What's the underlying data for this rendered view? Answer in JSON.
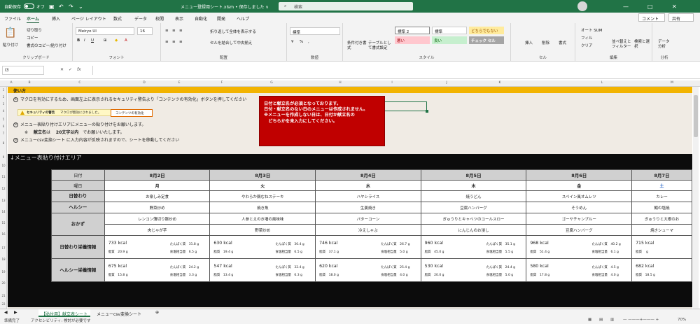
{
  "titlebar": {
    "autosave_label": "自動保存",
    "autosave_state": "オフ",
    "doc_title": "メニュー登録用シート.xlsm • 保存しました ∨",
    "search_placeholder": "検索",
    "bg_color": "#217346"
  },
  "menu": {
    "items": [
      "ファイル",
      "ホーム",
      "挿入",
      "ページ レイアウト",
      "数式",
      "データ",
      "校閲",
      "表示",
      "自動化",
      "開発",
      "ヘルプ"
    ],
    "active": "ホーム",
    "comment_label": "コメント",
    "share_label": "共有"
  },
  "ribbon": {
    "paste_label": "貼り付け",
    "cut_label": "切り取り",
    "copy_label": "コピー",
    "format_painter_label": "書式のコピー/貼り付け",
    "clipboard_group": "クリップボード",
    "font_name": "Meiryo UI",
    "font_size": "16",
    "font_group": "フォント",
    "wrap_label": "折り返して全体を表示する",
    "merge_label": "セルを結合して中央揃え",
    "align_group": "配置",
    "number_format": "標準",
    "number_group": "数値",
    "cond_format_label": "条件付き書式",
    "table_format_label": "テーブルとして書式設定",
    "styles": [
      {
        "label": "標準 2",
        "bg": "#ffffff",
        "fg": "#222222"
      },
      {
        "label": "標準",
        "bg": "#ffffff",
        "fg": "#222222"
      },
      {
        "label": "どちらでもない",
        "bg": "#ffeb9c",
        "fg": "#9c5700"
      },
      {
        "label": "悪い",
        "bg": "#ffc7ce",
        "fg": "#9c0006"
      },
      {
        "label": "良い",
        "bg": "#c6efce",
        "fg": "#006100"
      },
      {
        "label": "チェック セル",
        "bg": "#a5a5a5",
        "fg": "#ffffff"
      }
    ],
    "style_group": "スタイル",
    "insert_label": "挿入",
    "delete_label": "削除",
    "format_label": "書式",
    "cells_group": "セル",
    "autosum_label": "オート SUM",
    "fill_label": "フィル",
    "clear_label": "クリア",
    "sort_label": "並べ替えとフィルター",
    "find_label": "検索と選択",
    "edit_group": "編集",
    "analyze_label": "データ分析",
    "analyze_group": "分析"
  },
  "formula_bar": {
    "name_box": "I3",
    "formula": ""
  },
  "columns": [
    "A",
    "B",
    "C",
    "D",
    "E",
    "F",
    "G",
    "H",
    "I",
    "J",
    "K",
    "L",
    "M"
  ],
  "rows": [
    "1",
    "2",
    "3",
    "4",
    "5",
    "6",
    "7",
    "8",
    "9",
    "10",
    "11",
    "12",
    "13",
    "14",
    "15",
    "16",
    "17",
    "18",
    "19",
    "20",
    "21",
    "22"
  ],
  "sheet": {
    "usage_title": "使い方",
    "step1_num": "①",
    "step1": "マクロを有効にするため、画面左上に表示されるセキュリティ警告より「コンテンツの有効化」ボタンを押してください",
    "warn_title": "セキュリティの警告",
    "warn_text": "マクロが無効にされました。",
    "warn_button": "コンテンツの有効化",
    "step2_num": "②",
    "step2": "メニュー表貼り付けエリアにメニューの貼り付けをお願いします。",
    "note_prefix": "※",
    "note_bold1": "献立名",
    "note_mid": "は",
    "note_bold2": "20文字以内",
    "note_rest": "でお願いいたします。",
    "step3_num": "③",
    "step3": "メニューcsv変換シート に入力内容が反映されますので、シートを移動してください",
    "red_lines": [
      "日付と献立名が必須となっております。",
      "日付・献立名のない日のメニューは作成されません。",
      "※メニューを作成しない日は、日付か献立名の",
      "　どちらかを未入力にしてください。"
    ],
    "red_color": "#c00000",
    "banner_color": "#f2b300",
    "area_title": "↓メニュー表貼り付けエリア"
  },
  "menu_table": {
    "labels": {
      "date": "日付",
      "weekday": "曜日",
      "daily": "日替わり",
      "healthy": "ヘルシー",
      "side": "おかず",
      "daily_nutrition": "日替わり栄養情報",
      "healthy_nutrition": "ヘルシー栄養情報"
    },
    "units": {
      "kcal": "kcal",
      "protein": "たんぱく質",
      "fat": "脂質",
      "salt": "食塩相当量",
      "g": "g"
    },
    "days": [
      {
        "date": "8月2日",
        "weekday": "月",
        "weekday_color": "#222222",
        "daily": "お楽しみ定食",
        "healthy": "野菜炒め",
        "side1": "レンコン薄切り豚炒め",
        "side2": "肉じゃが芋",
        "dn": {
          "kcal": "733",
          "protein": "31.8",
          "fat": "20.9",
          "salt": "6.5"
        },
        "hn": {
          "kcal": "675",
          "protein": "24.2",
          "fat": "15.8",
          "salt": "3.3"
        }
      },
      {
        "date": "8月3日",
        "weekday": "火",
        "weekday_color": "#222222",
        "daily": "やわらか鶏むねステーキ",
        "healthy": "焼き魚",
        "side1": "人参とえのき増の風味味",
        "side2": "野菜炒め",
        "dn": {
          "kcal": "630",
          "protein": "30.4",
          "fat": "19.4",
          "salt": "6.5"
        },
        "hn": {
          "kcal": "547",
          "protein": "32.4",
          "fat": "13.4",
          "salt": "6.3"
        }
      },
      {
        "date": "8月4日",
        "weekday": "水",
        "weekday_color": "#222222",
        "daily": "ハヤシライス",
        "healthy": "生姜焼き",
        "side1": "バターコーン",
        "side2": "冷えしゃぶ",
        "dn": {
          "kcal": "746",
          "protein": "26.7",
          "fat": "37.1",
          "salt": "5.0"
        },
        "hn": {
          "kcal": "620",
          "protein": "25.4",
          "fat": "18.0",
          "salt": "4.0"
        }
      },
      {
        "date": "8月5日",
        "weekday": "木",
        "weekday_color": "#222222",
        "daily": "焼うどん",
        "healthy": "豆腐ハンバーグ",
        "side1": "ぎゅうりとキャベツのコールスロー",
        "side2": "にんじんのお浸し",
        "dn": {
          "kcal": "960",
          "protein": "35.1",
          "fat": "45.0",
          "salt": "5.5"
        },
        "hn": {
          "kcal": "530",
          "protein": "24.4",
          "fat": "20.0",
          "salt": "5.0"
        }
      },
      {
        "date": "8月6日",
        "weekday": "金",
        "weekday_color": "#222222",
        "daily": "スペイン風オムレツ",
        "healthy": "そうめん",
        "side1": "ゴーヤチャンプルー",
        "side2": "豆腐ハンバーグ",
        "dn": {
          "kcal": "968",
          "protein": "40.2",
          "fat": "51.4",
          "salt": "6.1"
        },
        "hn": {
          "kcal": "580",
          "protein": "4.5",
          "fat": "17.8",
          "salt": "4.0"
        }
      },
      {
        "date": "8月7日",
        "weekday": "土",
        "weekday_color": "#1f5fc4",
        "daily": "カレー",
        "healthy": "鯖の塩焼",
        "side1": "ぎゅうりと大根のお",
        "side2": "焼きシューマ",
        "dn": {
          "kcal": "715",
          "protein": "",
          "fat": "",
          "salt": ""
        },
        "hn": {
          "kcal": "682",
          "protein": "",
          "fat": "18.5",
          "salt": ""
        }
      }
    ]
  },
  "tabs": {
    "active": "【貼付用】献立表シート",
    "other": "メニューcsv変換シート",
    "add": "⊕"
  },
  "status": {
    "ready": "準備完了",
    "accessibility": "アクセシビリティ: 検討が必要です",
    "zoom": "70%"
  }
}
